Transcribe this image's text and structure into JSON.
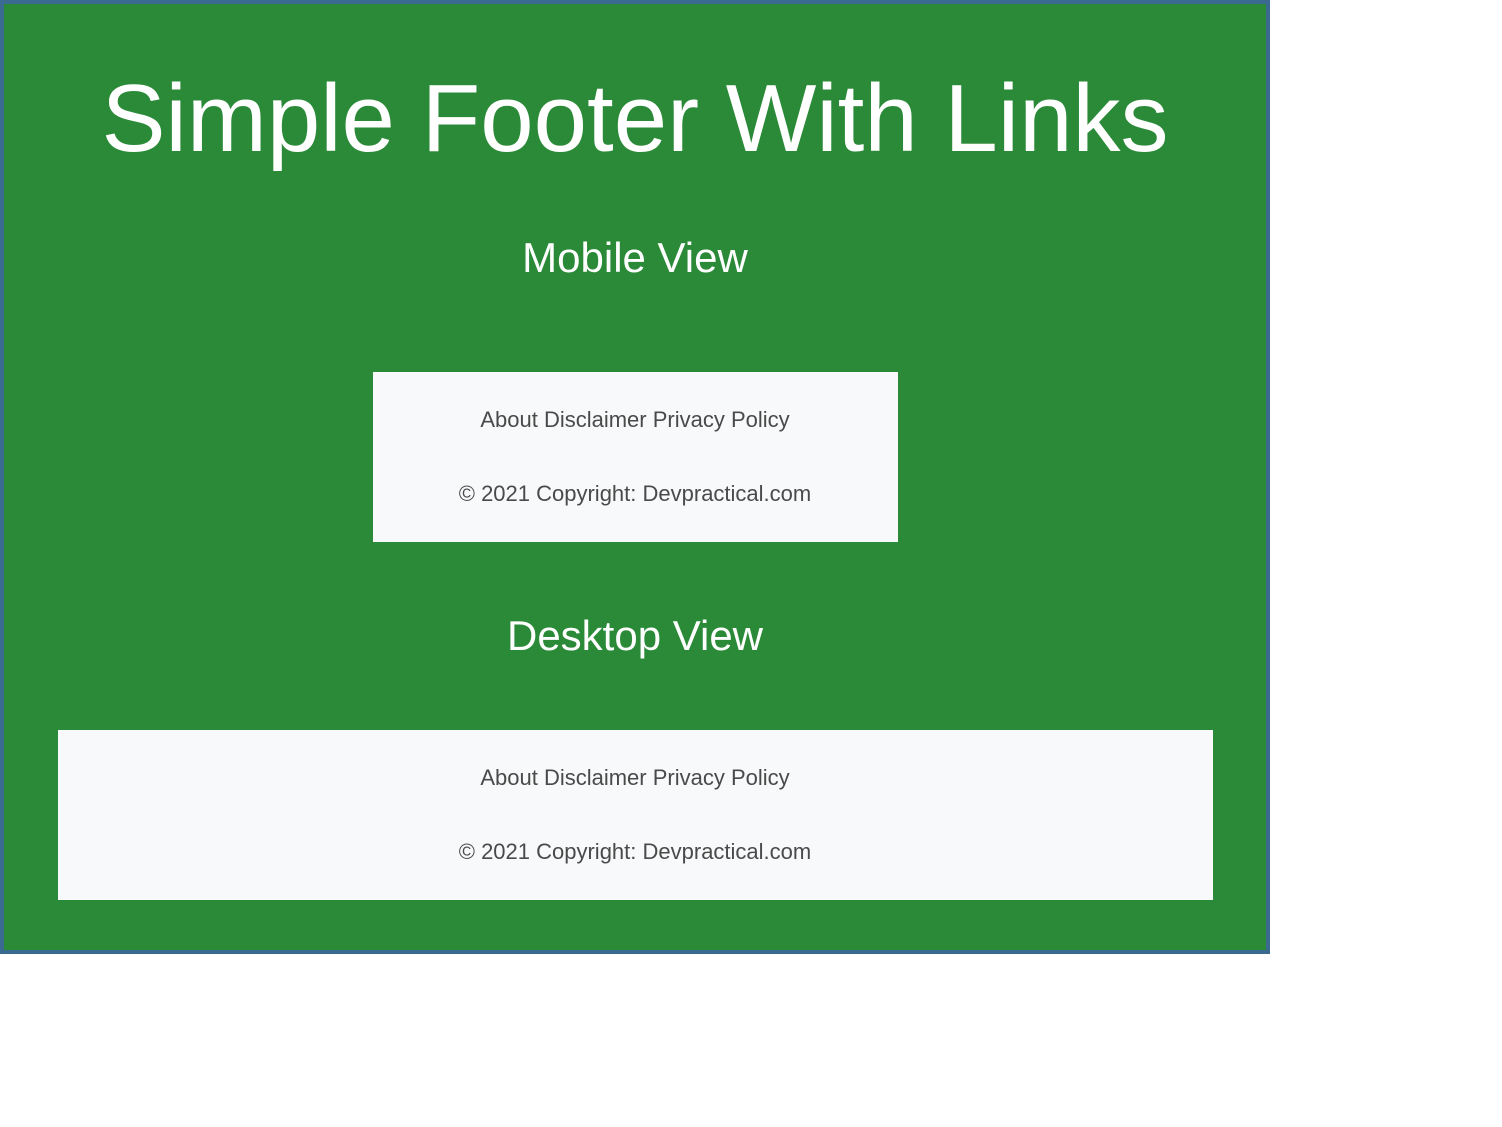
{
  "title": "Simple Footer With Links",
  "sections": {
    "mobile": {
      "label": "Mobile View",
      "links": {
        "about": "About",
        "disclaimer": "Disclaimer",
        "privacy": "Privacy Policy"
      },
      "copyright": "© 2021 Copyright: Devpractical.com"
    },
    "desktop": {
      "label": "Desktop View",
      "links": {
        "about": "About",
        "disclaimer": "Disclaimer",
        "privacy": "Privacy Policy"
      },
      "copyright": "© 2021 Copyright: Devpractical.com"
    }
  }
}
